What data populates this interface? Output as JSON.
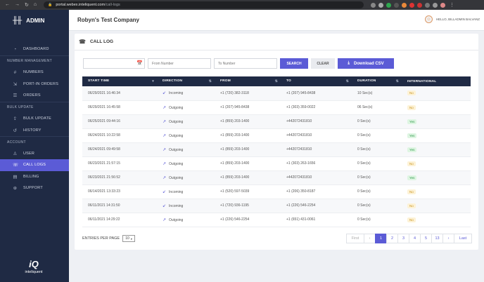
{
  "browser": {
    "url_host": "portal.webex.inteliquent.com",
    "url_path": "/call-logs"
  },
  "sidebar": {
    "brand": "ADMIN",
    "items": [
      {
        "type": "item",
        "label": "DASHBOARD",
        "icon": "gauge-icon"
      },
      {
        "type": "section",
        "label": "NUMBER MANAGEMENT"
      },
      {
        "type": "item",
        "label": "NUMBERS",
        "icon": "hash-icon"
      },
      {
        "type": "item",
        "label": "PORT-IN ORDERS",
        "icon": "port-in-icon"
      },
      {
        "type": "item",
        "label": "ORDERS",
        "icon": "orders-icon"
      },
      {
        "type": "section",
        "label": "BULK UPDATE"
      },
      {
        "type": "item",
        "label": "BULK UPDATE",
        "icon": "upload-icon"
      },
      {
        "type": "item",
        "label": "HISTORY",
        "icon": "history-icon"
      },
      {
        "type": "section",
        "label": "ACCOUNT"
      },
      {
        "type": "item",
        "label": "USER",
        "icon": "user-icon"
      },
      {
        "type": "item",
        "label": "CALL LOGS",
        "icon": "phone-icon",
        "active": true
      },
      {
        "type": "item",
        "label": "BILLING",
        "icon": "billing-icon"
      },
      {
        "type": "item",
        "label": "SUPPORT",
        "icon": "support-icon"
      }
    ],
    "logo_text": "inteliquent"
  },
  "header": {
    "company": "Robyn's Test Company",
    "greeting": "HELLO, BILLADMIN BALVANZ"
  },
  "page": {
    "title": "CALL LOG",
    "filters": {
      "from_placeholder": "From Number",
      "to_placeholder": "To Number",
      "search_label": "SEARCH",
      "clear_label": "CLEAR",
      "csv_label": "Download CSV"
    },
    "table": {
      "columns": [
        "START TIME",
        "DIRECTION",
        "FROM",
        "TO",
        "DURATION",
        "INTERNATIONAL"
      ],
      "rows": [
        [
          "06/29/2021 16:46:34",
          "Incoming",
          "+1 (720) 382-3118",
          "+1 (207) 945-8438",
          "10 Sec(s)",
          "No"
        ],
        [
          "06/29/2021 16:45:58",
          "Outgoing",
          "+1 (207) 945-8438",
          "+1 (303) 359-0022",
          "06 Sec(s)",
          "No"
        ],
        [
          "06/25/2021 09:44:16",
          "Outgoing",
          "+1 (859) 203-1400",
          "+442072431810",
          "0 Sec(s)",
          "Yes"
        ],
        [
          "06/24/2021 10:22:58",
          "Outgoing",
          "+1 (859) 203-1400",
          "+442072431810",
          "0 Sec(s)",
          "Yes"
        ],
        [
          "06/24/2021 09:49:58",
          "Outgoing",
          "+1 (859) 203-1400",
          "+442072431810",
          "0 Sec(s)",
          "Yes"
        ],
        [
          "06/23/2021 21:57:15",
          "Outgoing",
          "+1 (859) 203-1400",
          "+1 (303) 263-1656",
          "0 Sec(s)",
          "No"
        ],
        [
          "06/23/2021 21:56:52",
          "Outgoing",
          "+1 (859) 203-1400",
          "+442072431810",
          "0 Sec(s)",
          "Yes"
        ],
        [
          "06/14/2021 13:33:23",
          "Incoming",
          "+1 (520) 597-5039",
          "+1 (206) 350-8187",
          "0 Sec(s)",
          "No"
        ],
        [
          "06/11/2021 14:31:50",
          "Incoming",
          "+1 (720) 936-1195",
          "+1 (226) 546-2254",
          "0 Sec(s)",
          "No"
        ],
        [
          "06/11/2021 14:29:22",
          "Outgoing",
          "+1 (226) 546-2254",
          "+1 (651) 431-0061",
          "0 Sec(s)",
          "No"
        ]
      ]
    },
    "entries_per_page_label": "ENTRIES PER PAGE",
    "entries_per_page_value": "10",
    "pagination": {
      "first": "First",
      "prev": "‹",
      "pages": [
        "1",
        "2",
        "3",
        "4",
        "5",
        "13"
      ],
      "current": "1",
      "next": "›",
      "last": "Last"
    }
  }
}
